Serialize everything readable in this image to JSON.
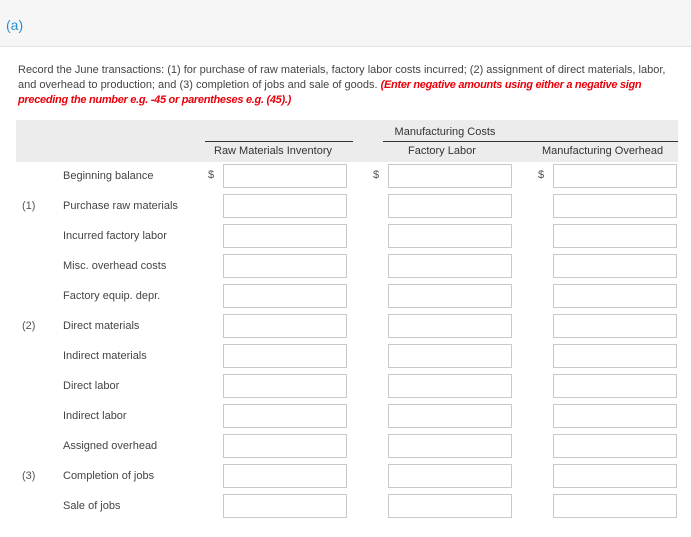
{
  "part": {
    "label": "(a)"
  },
  "instructions": {
    "text": "Record the June transactions: (1) for purchase of raw materials, factory labor costs incurred; (2) assignment of direct materials, labor, and overhead to production; and (3) completion of jobs and sale of goods. ",
    "note": "(Enter negative amounts using either a negative sign preceding the number e.g. -45 or parentheses e.g. (45).)"
  },
  "table": {
    "group_header": "Manufacturing Costs",
    "columns": [
      "Raw Materials Inventory",
      "Factory Labor",
      "Manufacturing Overhead"
    ],
    "currency_symbol": "$",
    "rows": [
      {
        "num": "",
        "label": "Beginning balance",
        "values": [
          "",
          "",
          ""
        ],
        "show_currency": true
      },
      {
        "num": "(1)",
        "label": "Purchase raw materials",
        "values": [
          "",
          "",
          ""
        ],
        "show_currency": false
      },
      {
        "num": "",
        "label": "Incurred factory labor",
        "values": [
          "",
          "",
          ""
        ],
        "show_currency": false
      },
      {
        "num": "",
        "label": "Misc. overhead costs",
        "values": [
          "",
          "",
          ""
        ],
        "show_currency": false
      },
      {
        "num": "",
        "label": "Factory equip. depr.",
        "values": [
          "",
          "",
          ""
        ],
        "show_currency": false
      },
      {
        "num": "(2)",
        "label": "Direct materials",
        "values": [
          "",
          "",
          ""
        ],
        "show_currency": false
      },
      {
        "num": "",
        "label": "Indirect materials",
        "values": [
          "",
          "",
          ""
        ],
        "show_currency": false
      },
      {
        "num": "",
        "label": "Direct labor",
        "values": [
          "",
          "",
          ""
        ],
        "show_currency": false
      },
      {
        "num": "",
        "label": "Indirect labor",
        "values": [
          "",
          "",
          ""
        ],
        "show_currency": false
      },
      {
        "num": "",
        "label": "Assigned overhead",
        "values": [
          "",
          "",
          ""
        ],
        "show_currency": false
      },
      {
        "num": "(3)",
        "label": "Completion of jobs",
        "values": [
          "",
          "",
          ""
        ],
        "show_currency": false
      },
      {
        "num": "",
        "label": "Sale of jobs",
        "values": [
          "",
          "",
          ""
        ],
        "show_currency": false
      }
    ]
  },
  "colors": {
    "part_label": "#2a8fd6",
    "note": "#e8000b",
    "header_band": "#ececec"
  }
}
